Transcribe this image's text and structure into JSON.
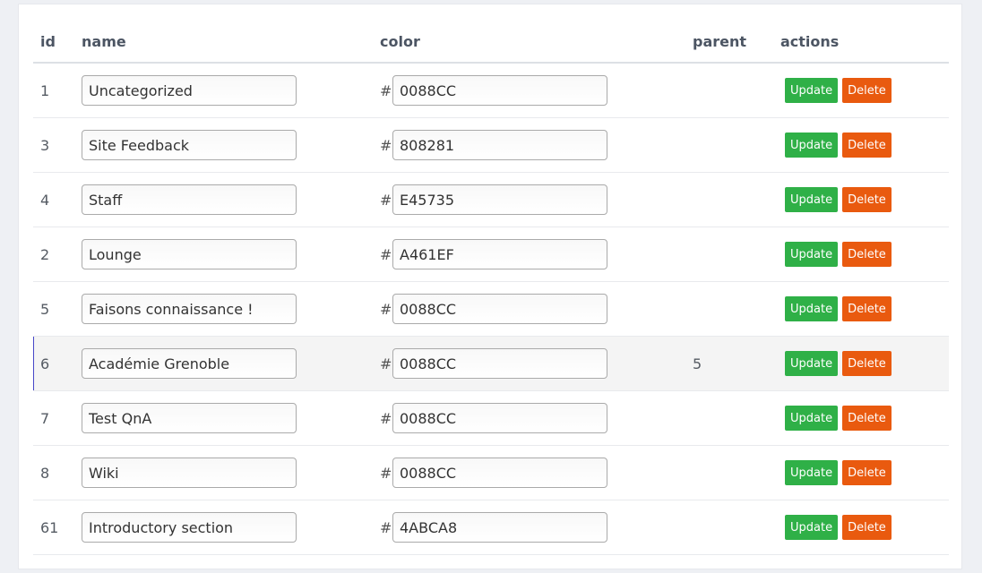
{
  "columns": {
    "id": "id",
    "name": "name",
    "color": "color",
    "parent": "parent",
    "actions": "actions"
  },
  "color_prefix": "#",
  "buttons": {
    "update": "Update",
    "delete": "Delete"
  },
  "colors": {
    "update_button": "#2fb047",
    "delete_button": "#e95a0f",
    "selected_row_marker": "#4646c8"
  },
  "selected_row_id": "6",
  "categories": [
    {
      "id": "1",
      "name": "Uncategorized",
      "color": "0088CC",
      "parent": ""
    },
    {
      "id": "3",
      "name": "Site Feedback",
      "color": "808281",
      "parent": ""
    },
    {
      "id": "4",
      "name": "Staff",
      "color": "E45735",
      "parent": ""
    },
    {
      "id": "2",
      "name": "Lounge",
      "color": "A461EF",
      "parent": ""
    },
    {
      "id": "5",
      "name": "Faisons connaissance !",
      "color": "0088CC",
      "parent": ""
    },
    {
      "id": "6",
      "name": "Académie Grenoble",
      "color": "0088CC",
      "parent": "5"
    },
    {
      "id": "7",
      "name": "Test QnA",
      "color": "0088CC",
      "parent": ""
    },
    {
      "id": "8",
      "name": "Wiki",
      "color": "0088CC",
      "parent": ""
    },
    {
      "id": "61",
      "name": "Introductory section",
      "color": "4ABCA8",
      "parent": ""
    }
  ]
}
